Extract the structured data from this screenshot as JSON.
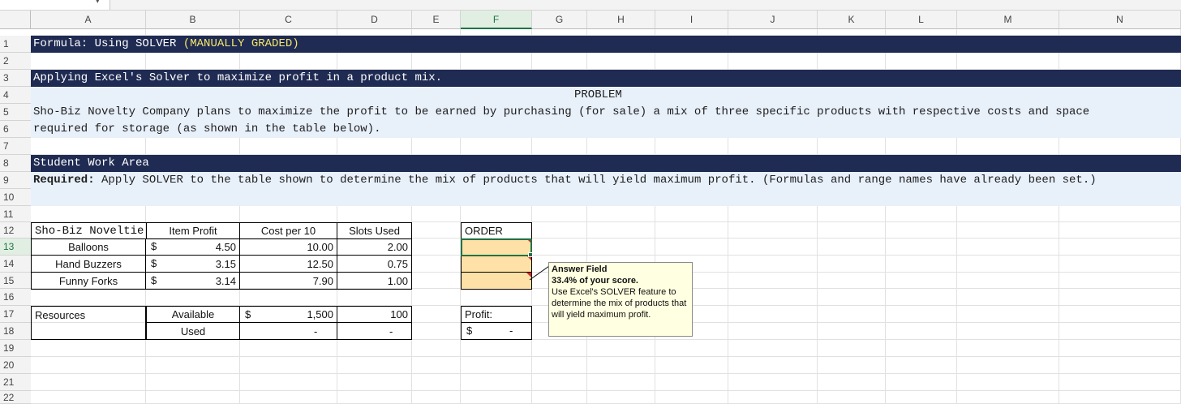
{
  "sheet": {
    "columns": [
      "A",
      "B",
      "C",
      "D",
      "E",
      "F",
      "G",
      "H",
      "I",
      "J",
      "K",
      "L",
      "M",
      "N"
    ],
    "rows": [
      "1",
      "2",
      "3",
      "4",
      "5",
      "6",
      "7",
      "8",
      "9",
      "10",
      "11",
      "12",
      "13",
      "14",
      "15",
      "16",
      "17",
      "18",
      "19",
      "20",
      "21",
      "22"
    ],
    "selected_column": "F",
    "selected_row": "13"
  },
  "header": {
    "row1_main": "Formula: Using SOLVER ",
    "row1_tag": "(MANUALLY GRADED)",
    "row3": "Applying Excel's Solver to maximize profit in a product mix.",
    "problem_title": "PROBLEM",
    "problem_line1": "Sho-Biz Novelty Company plans to maximize the profit to be earned by purchasing (for sale) a mix of three specific products with respective costs and space",
    "problem_line2": "required for storage (as shown in the table below).",
    "row8": "Student Work Area",
    "row9_bold": "Required:",
    "row9_rest": " Apply SOLVER to the table shown to determine the mix of products that will yield maximum profit. (Formulas and range names have already been set.)"
  },
  "table": {
    "title": "Sho-Biz Noveltie",
    "col_item_profit": "Item Profit",
    "col_cost": "Cost per 10",
    "col_slots": "Slots Used",
    "col_order": "ORDER",
    "currency": "$",
    "products": [
      {
        "name": "Balloons",
        "profit": "4.50",
        "cost": "10.00",
        "slots": "2.00"
      },
      {
        "name": "Hand Buzzers",
        "profit": "3.15",
        "cost": "12.50",
        "slots": "0.75"
      },
      {
        "name": "Funny Forks",
        "profit": "3.14",
        "cost": "7.90",
        "slots": "1.00"
      }
    ],
    "resources_label": "Resources",
    "available_label": "Available",
    "used_label": "Used",
    "available_cost": "1,500",
    "available_slots": "100",
    "used_cost": "-",
    "used_slots": "-",
    "profit_label": "Profit:",
    "profit_value": "-"
  },
  "comment": {
    "title": "Answer Field",
    "score": "33.4% of your score.",
    "text": "Use Excel's SOLVER feature to determine the mix of products that will yield maximum profit."
  },
  "colors": {
    "band": "#1f2b52",
    "highlight": "#f5e66a",
    "light_band": "#e8f0fa",
    "answer_fill": "#fde1a6",
    "selection": "#217346"
  }
}
